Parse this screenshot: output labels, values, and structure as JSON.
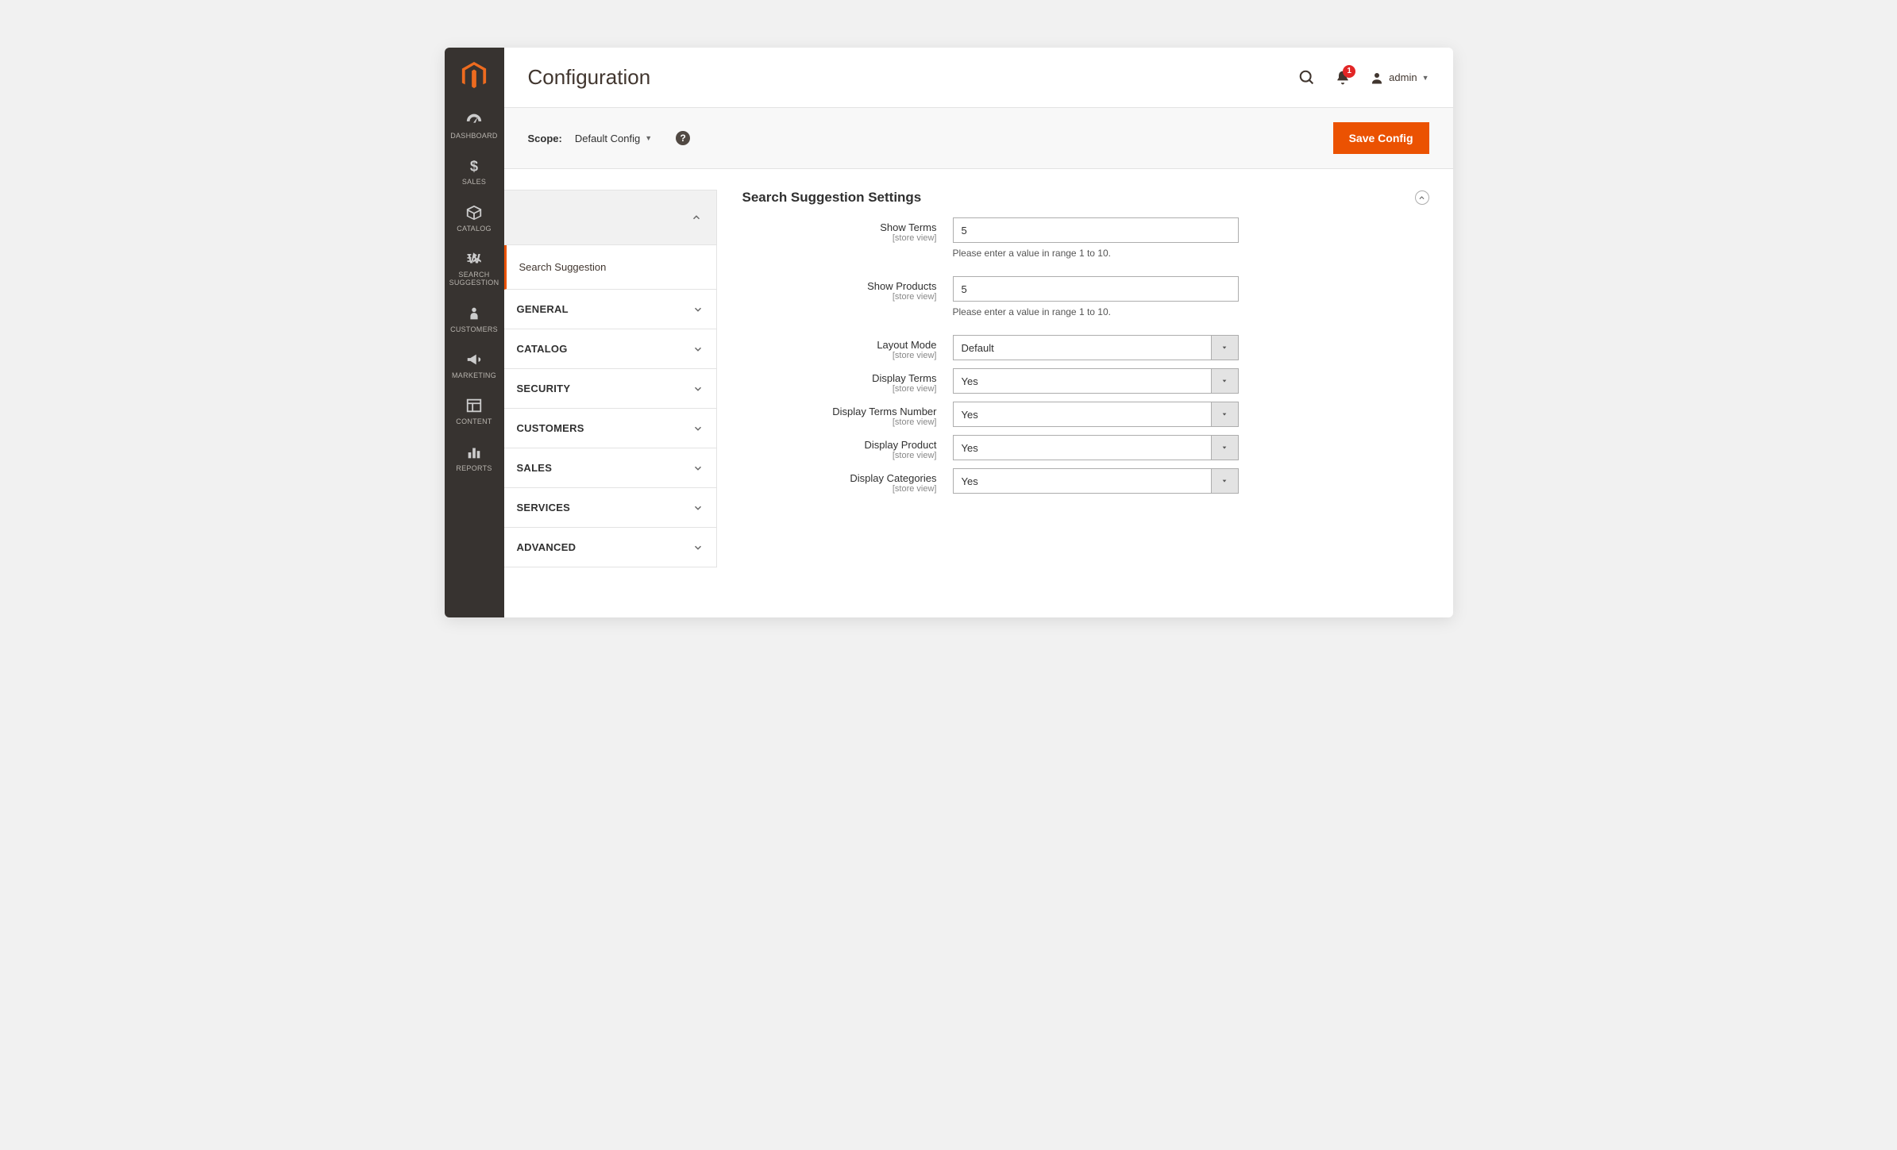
{
  "header": {
    "page_title": "Configuration",
    "notification_count": "1",
    "user_name": "admin"
  },
  "scope_bar": {
    "label": "Scope:",
    "value": "Default Config",
    "save_label": "Save Config"
  },
  "sidebar": {
    "items": [
      {
        "label": "DASHBOARD"
      },
      {
        "label": "SALES"
      },
      {
        "label": "CATALOG"
      },
      {
        "label": "SEARCH SUGGESTION"
      },
      {
        "label": "CUSTOMERS"
      },
      {
        "label": "MARKETING"
      },
      {
        "label": "CONTENT"
      },
      {
        "label": "REPORTS"
      }
    ]
  },
  "config_nav": {
    "active": "Search Suggestion",
    "sections": [
      "GENERAL",
      "CATALOG",
      "SECURITY",
      "CUSTOMERS",
      "SALES",
      "SERVICES",
      "ADVANCED"
    ]
  },
  "fieldset": {
    "title": "Search Suggestion Settings",
    "scope_hint": "[store view]",
    "fields": {
      "show_terms": {
        "label": "Show Terms",
        "value": "5",
        "hint": "Please enter a value in range 1 to 10."
      },
      "show_products": {
        "label": "Show Products",
        "value": "5",
        "hint": "Please enter a value in range 1 to 10."
      },
      "layout_mode": {
        "label": "Layout Mode",
        "value": "Default"
      },
      "display_terms": {
        "label": "Display Terms",
        "value": "Yes"
      },
      "display_terms_number": {
        "label": "Display Terms Number",
        "value": "Yes"
      },
      "display_product": {
        "label": "Display Product",
        "value": "Yes"
      },
      "display_categories": {
        "label": "Display Categories",
        "value": "Yes"
      }
    }
  }
}
